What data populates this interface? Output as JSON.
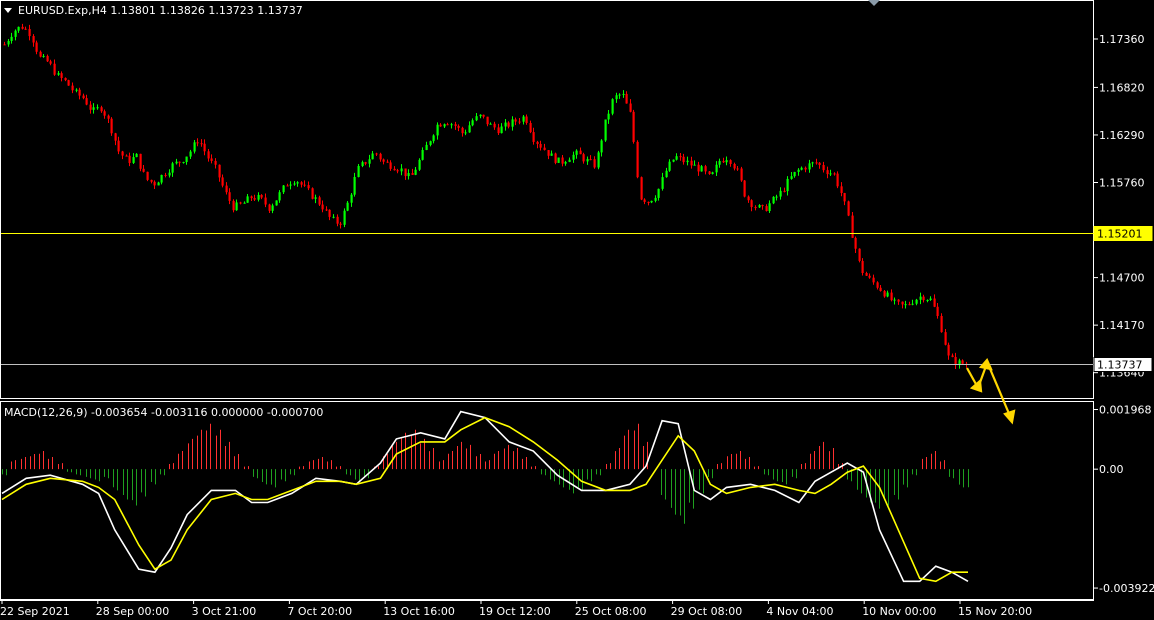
{
  "symbol_header": "EURUSD.Exp,H4  1.13801 1.13826 1.13723 1.13737",
  "macd_header": "MACD(12,26,9) -0.003654 -0.003116 0.000000 -0.000700",
  "colors": {
    "background": "#000000",
    "bull": "#00ff00",
    "bear": "#ff0000",
    "support_line": "#ffff00",
    "current_price_line": "#c0c0c0",
    "macd_main": "#ffffff",
    "macd_signal": "#ffff00",
    "hist_positive": "#ff3030",
    "hist_negative": "#1fa01f",
    "annotation_arrow": "#ffd700"
  },
  "chart_data": [
    {
      "type": "candlestick",
      "title": "EURUSD.Exp,H4",
      "ylim": [
        1.1338,
        1.1775
      ],
      "y_ticks": [
        "1.17360",
        "1.16820",
        "1.16290",
        "1.15760",
        "1.14700",
        "1.14170",
        "1.13640"
      ],
      "x_ticks": [
        "22 Sep 2021",
        "28 Sep 00:00",
        "3 Oct 21:00",
        "7 Oct 20:00",
        "13 Oct 16:00",
        "19 Oct 12:00",
        "25 Oct 08:00",
        "29 Oct 08:00",
        "4 Nov 04:00",
        "10 Nov 00:00",
        "15 Nov 20:00"
      ],
      "horizontal_lines": [
        {
          "price": 1.15201,
          "label": "1.15201",
          "style": "support"
        },
        {
          "price": 1.13737,
          "label": "1.13737",
          "style": "current"
        }
      ],
      "close_path": [
        [
          0,
          1.173
        ],
        [
          1,
          1.1745
        ],
        [
          2,
          1.175
        ],
        [
          3,
          1.1742
        ],
        [
          4,
          1.1715
        ],
        [
          5,
          1.171
        ],
        [
          6,
          1.1695
        ],
        [
          7,
          1.1688
        ],
        [
          8,
          1.1676
        ],
        [
          9,
          1.167
        ],
        [
          10,
          1.1655
        ],
        [
          11,
          1.166
        ],
        [
          12,
          1.164
        ],
        [
          13,
          1.161
        ],
        [
          14,
          1.16
        ],
        [
          15,
          1.1605
        ],
        [
          16,
          1.158
        ],
        [
          17,
          1.1575
        ],
        [
          18,
          1.1585
        ],
        [
          19,
          1.1595
        ],
        [
          20,
          1.16
        ],
        [
          21,
          1.161
        ],
        [
          22,
          1.1625
        ],
        [
          23,
          1.1605
        ],
        [
          24,
          1.159
        ],
        [
          25,
          1.1565
        ],
        [
          26,
          1.1548
        ],
        [
          27,
          1.1552
        ],
        [
          28,
          1.156
        ],
        [
          29,
          1.1558
        ],
        [
          30,
          1.1548
        ],
        [
          31,
          1.156
        ],
        [
          32,
          1.1575
        ],
        [
          33,
          1.158
        ],
        [
          34,
          1.157
        ],
        [
          35,
          1.156
        ],
        [
          36,
          1.155
        ],
        [
          37,
          1.1535
        ],
        [
          38,
          1.153
        ],
        [
          39,
          1.1555
        ],
        [
          40,
          1.159
        ],
        [
          41,
          1.16
        ],
        [
          42,
          1.161
        ],
        [
          43,
          1.1598
        ],
        [
          44,
          1.1595
        ],
        [
          45,
          1.159
        ],
        [
          46,
          1.158
        ],
        [
          47,
          1.16
        ],
        [
          48,
          1.162
        ],
        [
          49,
          1.164
        ],
        [
          50,
          1.1645
        ],
        [
          51,
          1.164
        ],
        [
          52,
          1.163
        ],
        [
          53,
          1.1645
        ],
        [
          54,
          1.165
        ],
        [
          55,
          1.164
        ],
        [
          56,
          1.1635
        ],
        [
          57,
          1.164
        ],
        [
          58,
          1.1645
        ],
        [
          59,
          1.165
        ],
        [
          60,
          1.1625
        ],
        [
          61,
          1.1615
        ],
        [
          62,
          1.1605
        ],
        [
          63,
          1.1598
        ],
        [
          64,
          1.1605
        ],
        [
          65,
          1.1608
        ],
        [
          66,
          1.16
        ],
        [
          67,
          1.1595
        ],
        [
          68,
          1.164
        ],
        [
          69,
          1.167
        ],
        [
          70,
          1.1675
        ],
        [
          71,
          1.165
        ],
        [
          72,
          1.156
        ],
        [
          73,
          1.1555
        ],
        [
          74,
          1.1565
        ],
        [
          75,
          1.159
        ],
        [
          76,
          1.1605
        ],
        [
          77,
          1.16
        ],
        [
          78,
          1.1595
        ],
        [
          79,
          1.159
        ],
        [
          80,
          1.158
        ],
        [
          81,
          1.16
        ],
        [
          82,
          1.1605
        ],
        [
          83,
          1.159
        ],
        [
          84,
          1.156
        ],
        [
          85,
          1.155
        ],
        [
          86,
          1.1545
        ],
        [
          87,
          1.1555
        ],
        [
          88,
          1.1565
        ],
        [
          89,
          1.158
        ],
        [
          90,
          1.159
        ],
        [
          91,
          1.1595
        ],
        [
          92,
          1.1598
        ],
        [
          93,
          1.159
        ],
        [
          94,
          1.1585
        ],
        [
          95,
          1.156
        ],
        [
          96,
          1.152
        ],
        [
          97,
          1.148
        ],
        [
          98,
          1.1468
        ],
        [
          99,
          1.146
        ],
        [
          100,
          1.145
        ],
        [
          101,
          1.144
        ],
        [
          102,
          1.1438
        ],
        [
          103,
          1.1445
        ],
        [
          104,
          1.145
        ],
        [
          105,
          1.1445
        ],
        [
          106,
          1.142
        ],
        [
          107,
          1.138
        ],
        [
          108,
          1.1375
        ],
        [
          109,
          1.13737
        ]
      ]
    },
    {
      "type": "macd",
      "title": "MACD(12,26,9)",
      "ylim": [
        -0.00425,
        0.00215
      ],
      "y_ticks": [
        "0.001968",
        "0.00",
        "-0.003922"
      ],
      "main": [
        [
          0,
          -0.0008
        ],
        [
          3,
          -0.0003
        ],
        [
          6,
          -0.0002
        ],
        [
          10,
          -0.0005
        ],
        [
          12,
          -0.0008
        ],
        [
          14,
          -0.002
        ],
        [
          17,
          -0.0033
        ],
        [
          19,
          -0.0034
        ],
        [
          21,
          -0.0026
        ],
        [
          23,
          -0.0015
        ],
        [
          26,
          -0.0007
        ],
        [
          29,
          -0.0007
        ],
        [
          31,
          -0.0011
        ],
        [
          33,
          -0.0011
        ],
        [
          36,
          -0.0008
        ],
        [
          39,
          -0.0003
        ],
        [
          42,
          -0.0004
        ],
        [
          44,
          -0.0005
        ],
        [
          47,
          0.0002
        ],
        [
          49,
          0.001
        ],
        [
          52,
          0.0012
        ],
        [
          55,
          0.001
        ],
        [
          57,
          0.0019
        ],
        [
          60,
          0.0017
        ],
        [
          63,
          0.0009
        ],
        [
          66,
          0.0006
        ],
        [
          69,
          -0.0002
        ],
        [
          72,
          -0.0007
        ],
        [
          75,
          -0.0007
        ],
        [
          78,
          -0.0005
        ],
        [
          80,
          0.0001
        ],
        [
          82,
          0.0016
        ],
        [
          84,
          0.0015
        ],
        [
          86,
          -0.0007
        ],
        [
          88,
          -0.001
        ],
        [
          90,
          -0.0006
        ],
        [
          93,
          -0.0005
        ],
        [
          96,
          -0.0007
        ],
        [
          99,
          -0.0011
        ],
        [
          101,
          -0.0004
        ],
        [
          103,
          -0.0001
        ],
        [
          105,
          0.0002
        ],
        [
          107,
          -0.0001
        ],
        [
          109,
          -0.002
        ],
        [
          112,
          -0.0037
        ],
        [
          114,
          -0.0037
        ],
        [
          116,
          -0.0032
        ],
        [
          118,
          -0.0034
        ],
        [
          120,
          -0.0037
        ]
      ],
      "signal": [
        [
          0,
          -0.001
        ],
        [
          3,
          -0.0005
        ],
        [
          6,
          -0.0003
        ],
        [
          10,
          -0.0004
        ],
        [
          12,
          -0.0006
        ],
        [
          14,
          -0.001
        ],
        [
          17,
          -0.0025
        ],
        [
          19,
          -0.0033
        ],
        [
          21,
          -0.003
        ],
        [
          23,
          -0.002
        ],
        [
          26,
          -0.001
        ],
        [
          29,
          -0.0008
        ],
        [
          31,
          -0.001
        ],
        [
          33,
          -0.001
        ],
        [
          36,
          -0.0007
        ],
        [
          39,
          -0.0004
        ],
        [
          42,
          -0.0004
        ],
        [
          44,
          -0.0005
        ],
        [
          47,
          -0.0003
        ],
        [
          49,
          0.0005
        ],
        [
          52,
          0.0009
        ],
        [
          55,
          0.0009
        ],
        [
          57,
          0.0013
        ],
        [
          60,
          0.0017
        ],
        [
          63,
          0.0014
        ],
        [
          66,
          0.0009
        ],
        [
          69,
          0.0003
        ],
        [
          72,
          -0.0004
        ],
        [
          75,
          -0.0007
        ],
        [
          78,
          -0.0007
        ],
        [
          80,
          -0.0005
        ],
        [
          82,
          0.0003
        ],
        [
          84,
          0.0011
        ],
        [
          86,
          0.0006
        ],
        [
          88,
          -0.0005
        ],
        [
          90,
          -0.0008
        ],
        [
          93,
          -0.0006
        ],
        [
          96,
          -0.0005
        ],
        [
          99,
          -0.0007
        ],
        [
          101,
          -0.0008
        ],
        [
          103,
          -0.0005
        ],
        [
          105,
          -0.0001
        ],
        [
          107,
          0.0001
        ],
        [
          109,
          -0.0006
        ],
        [
          112,
          -0.0024
        ],
        [
          114,
          -0.0036
        ],
        [
          116,
          -0.0037
        ],
        [
          118,
          -0.0034
        ],
        [
          120,
          -0.0034
        ]
      ],
      "histogram": [
        [
          -0.0002,
          0.0003,
          0.0004,
          0.0005,
          0.0006,
          0.0004,
          0.0002,
          -0.0001,
          -0.0002,
          -0.0003,
          -0.0004,
          -0.0003
        ],
        [
          -0.0007,
          -0.001,
          -0.0012,
          -0.0009,
          -0.0005,
          -0.0002,
          0.0002,
          0.0006,
          0.001,
          0.0013,
          0.0015,
          0.0013
        ],
        [
          0.0009,
          0.0005,
          0.0001,
          -0.0003,
          -0.0005,
          -0.0006,
          -0.0004,
          -0.0002,
          0.0001,
          0.0003,
          0.0004,
          0.0003
        ],
        [
          0.0001,
          -0.0002,
          -0.0004,
          -0.0003,
          0.0001,
          0.0005,
          0.0009,
          0.0012,
          0.0013,
          0.001,
          0.0007,
          0.0003
        ],
        [
          0.0006,
          0.0009,
          0.0008,
          0.0005,
          0.0003,
          0.0006,
          0.0008,
          0.0007,
          0.0004,
          0.0001,
          -0.0002,
          -0.0004
        ],
        [
          -0.0006,
          -0.0008,
          -0.0007,
          -0.0004,
          -0.0002,
          0.0002,
          0.0007,
          0.0013,
          0.0015,
          0.0009,
          0.0,
          -0.001
        ],
        [
          -0.0015,
          -0.0018,
          -0.0013,
          -0.0008,
          -0.0003,
          0.0002,
          0.0005,
          0.0006,
          0.0004,
          0.0001,
          -0.0002,
          -0.0004
        ],
        [
          -0.0005,
          -0.0003,
          0.0002,
          0.0006,
          0.0009,
          0.0007,
          0.0002,
          -0.0004,
          -0.0008,
          -0.0011,
          -0.0013,
          -0.0012
        ],
        [
          -0.001,
          -0.0006,
          -0.0002,
          0.0004,
          0.0006,
          0.0003,
          -0.0003,
          -0.0006,
          -0.0007
        ]
      ]
    }
  ]
}
